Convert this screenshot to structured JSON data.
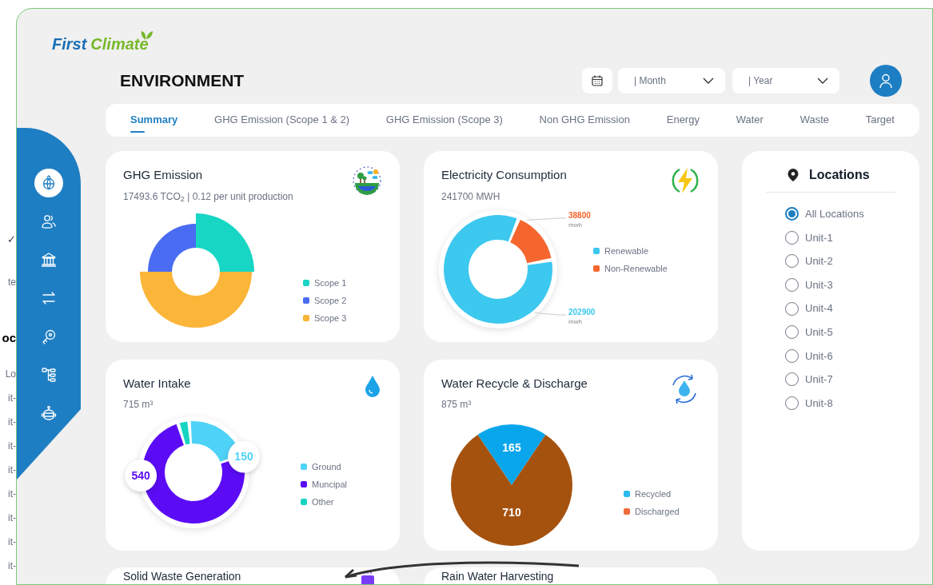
{
  "background_panel": {
    "items": [
      {
        "kind": "check",
        "text": "✓"
      },
      {
        "kind": "field",
        "text": "te"
      },
      {
        "kind": "heading",
        "text": "oc"
      },
      {
        "kind": "option",
        "text": "Lo"
      },
      {
        "kind": "option",
        "text": "it-"
      },
      {
        "kind": "option",
        "text": "it-"
      },
      {
        "kind": "option",
        "text": "it-"
      },
      {
        "kind": "option",
        "text": "it-"
      },
      {
        "kind": "option",
        "text": "it-"
      },
      {
        "kind": "option",
        "text": "it-"
      },
      {
        "kind": "option",
        "text": "it-"
      },
      {
        "kind": "option",
        "text": "it-"
      }
    ]
  },
  "logo": {
    "word_1": "First",
    "word_2": "Climate"
  },
  "sidebar": {
    "items": [
      {
        "kind": "globe",
        "selected": true
      },
      {
        "kind": "users",
        "selected": false
      },
      {
        "kind": "bank",
        "selected": false
      },
      {
        "kind": "arrows",
        "selected": false
      },
      {
        "kind": "key",
        "selected": false
      },
      {
        "kind": "hierarchy",
        "selected": false
      },
      {
        "kind": "robot",
        "selected": false
      }
    ]
  },
  "header": {
    "title": "ENVIRONMENT",
    "month": {
      "placeholder": "| Month"
    },
    "year": {
      "placeholder": "| Year"
    }
  },
  "tabs": [
    {
      "label": "Summary",
      "selected": true
    },
    {
      "label": "GHG Emission (Scope 1 & 2)",
      "selected": false
    },
    {
      "label": "GHG Emission (Scope 3)",
      "selected": false
    },
    {
      "label": "Non GHG Emission",
      "selected": false
    },
    {
      "label": "Energy",
      "selected": false
    },
    {
      "label": "Water",
      "selected": false
    },
    {
      "label": "Waste",
      "selected": false
    },
    {
      "label": "Target",
      "selected": false
    }
  ],
  "cards": [
    {
      "kind": "ghg",
      "title": "GHG Emission",
      "subtitle": "17493.6 TCO$_{2}$ | 0.12 per unit production",
      "legend": [
        {
          "label": "Scope 1",
          "color": "#17d6c4"
        },
        {
          "label": "Scope 2",
          "color": "#4a6cf2"
        },
        {
          "label": "Scope 3",
          "color": "#fbb538"
        }
      ]
    },
    {
      "kind": "electricity",
      "title": "Electricity Consumption",
      "subtitle": "241700 MWH",
      "legend": [
        {
          "color": "#3cc8ef"
        },
        {
          "color": "#f5662e"
        }
      ],
      "chart_data": {
        "type": "donut",
        "categories": [
          "Renewable",
          "Non-Renewable"
        ],
        "values": [
          202900,
          38800
        ],
        "value_labels": [
          "202900",
          "38800"
        ],
        "annotations": [
          "mwh",
          "mwh"
        ]
      }
    },
    {
      "kind": "intake",
      "title": "Water Intake",
      "subtitle": "715 m³",
      "legend": [
        {
          "color": "#4fd2f7"
        },
        {
          "color": "#5b0cf5"
        },
        {
          "color": "#17d4c2"
        }
      ],
      "chart_data": {
        "type": "donut",
        "categories": [
          "Ground",
          "Muncipal",
          "Other"
        ],
        "values": [
          150,
          540,
          25
        ],
        "value_labels": [
          "150",
          "540",
          null
        ]
      }
    },
    {
      "kind": "recycle",
      "title": "Water Recycle & Discharge",
      "subtitle": "875 m³",
      "legend": [
        {
          "color": "#2bb9ef"
        },
        {
          "color": "#f26b3a"
        }
      ],
      "chart_data": {
        "type": "pie",
        "categories": [
          "Recycled",
          "Discharged"
        ],
        "values": [
          165,
          710
        ],
        "data_labels": true
      }
    },
    {
      "kind": "partial",
      "title": "Solid Waste Generation"
    },
    {
      "kind": "partial",
      "title": "Rain Water Harvesting"
    }
  ],
  "locations": {
    "title": "Locations",
    "options": [
      {
        "label": "All Locations",
        "selected": true
      },
      {
        "label": "Unit-1",
        "selected": false
      },
      {
        "label": "Unit-2",
        "selected": false
      },
      {
        "label": "Unit-3",
        "selected": false
      },
      {
        "label": "Unit-4",
        "selected": false
      },
      {
        "label": "Unit-5",
        "selected": false
      },
      {
        "label": "Unit-6",
        "selected": false
      },
      {
        "label": "Unit-7",
        "selected": false
      },
      {
        "label": "Unit-8",
        "selected": false
      }
    ]
  }
}
